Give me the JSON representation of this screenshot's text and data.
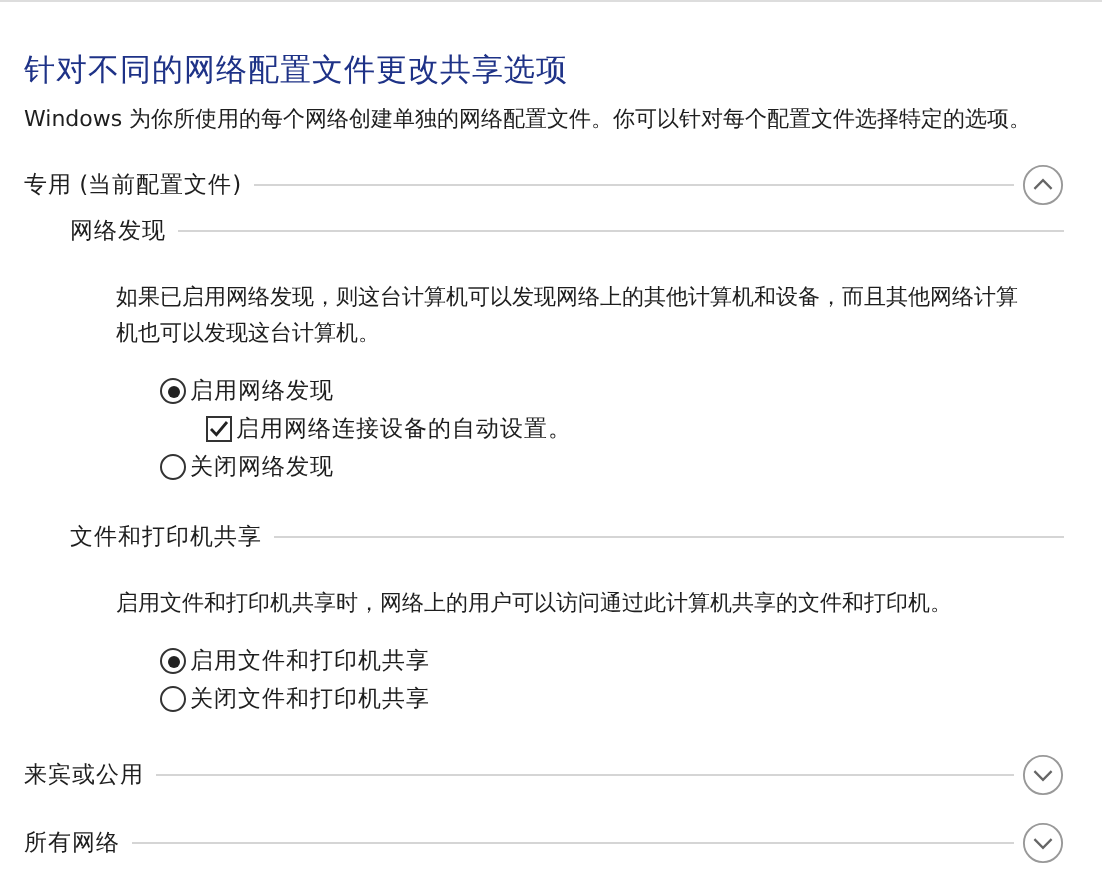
{
  "title": "针对不同的网络配置文件更改共享选项",
  "description": "Windows 为你所使用的每个网络创建单独的网络配置文件。你可以针对每个配置文件选择特定的选项。",
  "sections": [
    {
      "label": "专用 (当前配置文件)",
      "expanded": true,
      "subsections": [
        {
          "label": "网络发现",
          "description": "如果已启用网络发现，则这台计算机可以发现网络上的其他计算机和设备，而且其他网络计算机也可以发现这台计算机。",
          "options": [
            {
              "kind": "radio",
              "label": "启用网络发现",
              "selected": true,
              "children": [
                {
                  "kind": "checkbox",
                  "label": "启用网络连接设备的自动设置。",
                  "checked": true
                }
              ]
            },
            {
              "kind": "radio",
              "label": "关闭网络发现",
              "selected": false
            }
          ]
        },
        {
          "label": "文件和打印机共享",
          "description": "启用文件和打印机共享时，网络上的用户可以访问通过此计算机共享的文件和打印机。",
          "options": [
            {
              "kind": "radio",
              "label": "启用文件和打印机共享",
              "selected": true
            },
            {
              "kind": "radio",
              "label": "关闭文件和打印机共享",
              "selected": false
            }
          ]
        }
      ]
    },
    {
      "label": "来宾或公用",
      "expanded": false
    },
    {
      "label": "所有网络",
      "expanded": false
    }
  ]
}
